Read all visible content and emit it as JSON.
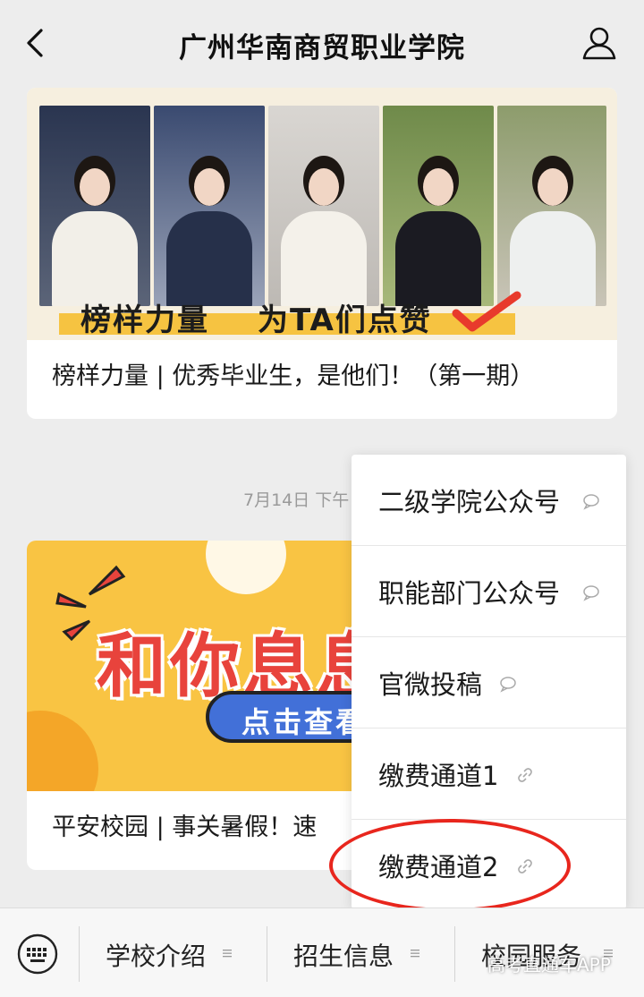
{
  "header": {
    "title": "广州华南商贸职业学院"
  },
  "articles": [
    {
      "cover_text_1": "榜样力量",
      "cover_text_2": "为TA们点赞",
      "title": "榜样力量 | 优秀毕业生，是他们！（第一期）"
    },
    {
      "cover_title": "和你息息",
      "cover_button": "点击查看",
      "title": "平安校园 | 事关暑假！速"
    }
  ],
  "timestamp": "7月14日 下午",
  "menu": {
    "items": [
      {
        "label": "二级学院公众号",
        "icon": "chat-bubble-icon"
      },
      {
        "label": "职能部门公众号",
        "icon": "chat-bubble-icon"
      },
      {
        "label": "官微投稿",
        "icon": "chat-bubble-icon"
      },
      {
        "label": "缴费通道1",
        "icon": "link-icon"
      },
      {
        "label": "缴费通道2",
        "icon": "link-icon"
      }
    ]
  },
  "bottom_bar": {
    "tabs": [
      {
        "label": "学校介绍"
      },
      {
        "label": "招生信息"
      },
      {
        "label": "校园服务"
      }
    ]
  },
  "watermark": "高考直通车APP",
  "colors": {
    "highlight_ring": "#e8261d",
    "background": "#ededed"
  }
}
